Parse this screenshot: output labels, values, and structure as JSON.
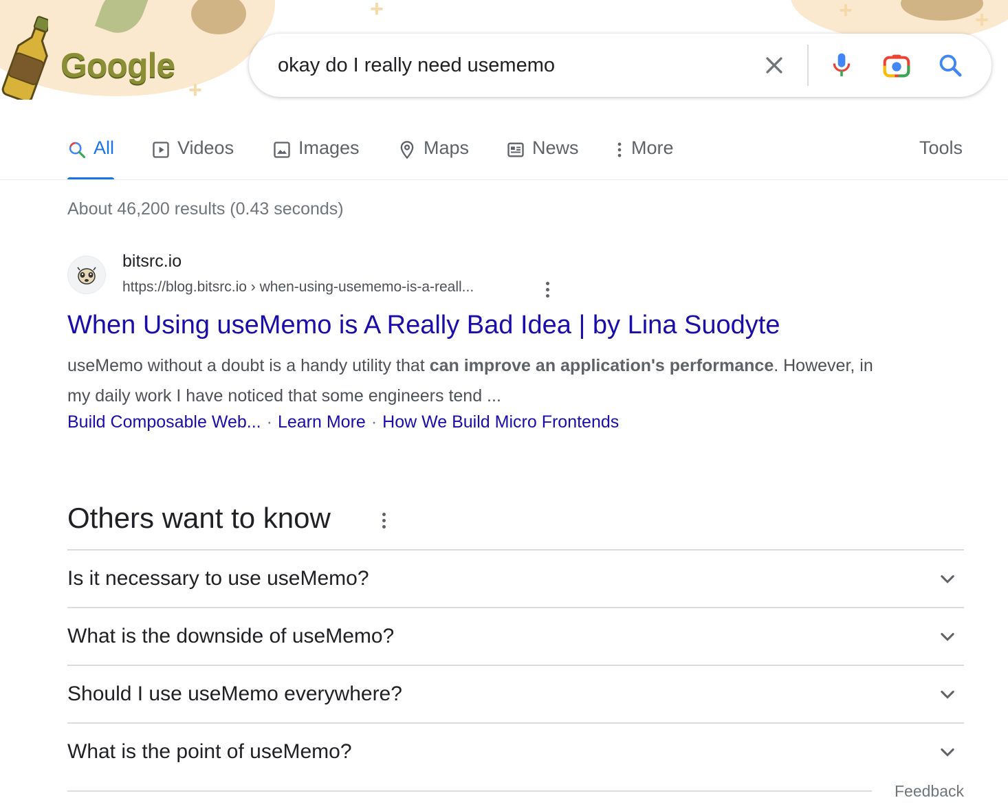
{
  "logo": {
    "text": "Google"
  },
  "search": {
    "query": "okay do I really need usememo"
  },
  "icons": {
    "clear": "close-icon",
    "voice": "microphone-icon",
    "lens": "camera-icon",
    "search": "search-icon"
  },
  "tabs": [
    {
      "label": "All",
      "icon": "search-icon",
      "active": true
    },
    {
      "label": "Videos",
      "icon": "video-icon"
    },
    {
      "label": "Images",
      "icon": "image-icon"
    },
    {
      "label": "Maps",
      "icon": "map-pin-icon"
    },
    {
      "label": "News",
      "icon": "newspaper-icon"
    },
    {
      "label": "More",
      "icon": "vertical-dots-icon"
    }
  ],
  "tools_label": "Tools",
  "result_stats": "About 46,200 results (0.43 seconds)",
  "result": {
    "site_name": "bitsrc.io",
    "url": "https://blog.bitsrc.io › when-using-usememo-is-a-reall...",
    "title": "When Using useMemo is A Really Bad Idea | by Lina Suodyte",
    "snippet_before": "useMemo without a doubt is a handy utility that ",
    "snippet_bold": "can improve an application's performance",
    "snippet_after": ". However, in my daily work I have noticed that some engineers tend ...",
    "sitelinks": [
      "Build Composable Web...",
      "Learn More",
      "How We Build Micro Frontends"
    ],
    "sitelink_separator": "·"
  },
  "others_want_to_know": {
    "title": "Others want to know",
    "questions": [
      "Is it necessary to use useMemo?",
      "What is the downside of useMemo?",
      "Should I use useMemo everywhere?",
      "What is the point of useMemo?"
    ]
  },
  "feedback_label": "Feedback",
  "colors": {
    "link": "#1a0dab",
    "active_tab": "#1a73e8",
    "muted": "#5f6368"
  }
}
